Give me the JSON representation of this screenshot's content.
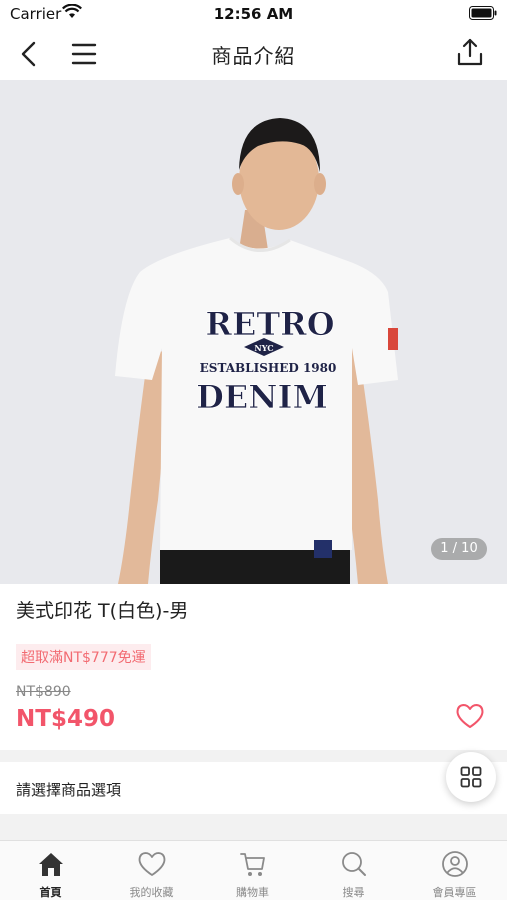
{
  "status_bar": {
    "carrier": "Carrier",
    "time": "12:56 AM"
  },
  "nav": {
    "title": "商品介紹"
  },
  "hero": {
    "shirt_print": {
      "line1": "RETRO",
      "badge": "NYC",
      "line2": "ESTABLISHED 1980",
      "line3": "DENIM"
    },
    "counter": "1 / 10"
  },
  "product": {
    "name": "美式印花 T(白色)-男",
    "promo": "超取滿NT$777免運",
    "original_price": "NT$890",
    "price": "NT$490"
  },
  "options": {
    "label": "請選擇商品選項"
  },
  "tabs": [
    {
      "label": "首頁",
      "icon": "home-icon",
      "active": true
    },
    {
      "label": "我的收藏",
      "icon": "heart-icon",
      "active": false
    },
    {
      "label": "購物車",
      "icon": "cart-icon",
      "active": false
    },
    {
      "label": "搜尋",
      "icon": "search-icon",
      "active": false
    },
    {
      "label": "會員專區",
      "icon": "user-icon",
      "active": false
    }
  ],
  "colors": {
    "accent": "#f2556a",
    "promo_bg": "#fdecee",
    "promo_text": "#f26b72",
    "print_navy": "#1f2347"
  }
}
